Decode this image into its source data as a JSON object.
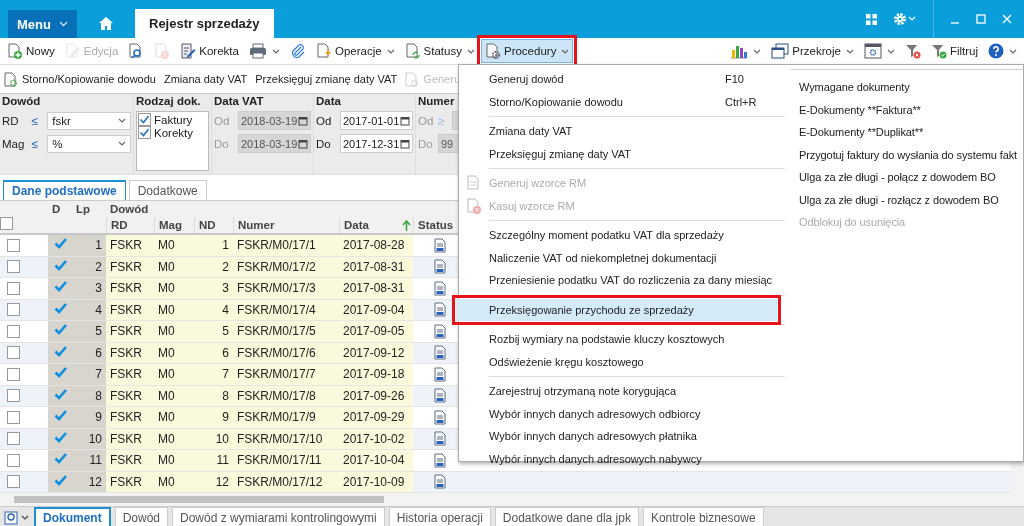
{
  "title_bar": {
    "menu": "Menu",
    "tabs": [
      {
        "label": "Rejestr sprzedaży",
        "selected": true
      }
    ]
  },
  "toolbar": {
    "left": [
      {
        "kind": "new",
        "label": "Nowy",
        "dropdown": false,
        "disabled": false,
        "open": false
      },
      {
        "kind": "edit",
        "label": "Edycja",
        "dropdown": false,
        "disabled": true,
        "open": false
      },
      {
        "kind": "preview",
        "dropdown": false,
        "disabled": false,
        "open": false
      },
      {
        "kind": "delete",
        "dropdown": false,
        "disabled": true,
        "open": false
      },
      {
        "kind": "correct",
        "label": "Korekta",
        "dropdown": false,
        "disabled": false,
        "open": false
      },
      {
        "kind": "print",
        "dropdown": true,
        "disabled": false,
        "open": false
      },
      {
        "kind": "clip",
        "dropdown": false,
        "disabled": false,
        "open": false
      },
      {
        "kind": "operations",
        "label": "Operacje",
        "dropdown": true,
        "disabled": false,
        "open": false
      },
      {
        "kind": "status",
        "label": "Statusy",
        "dropdown": true,
        "disabled": false,
        "open": false
      },
      {
        "kind": "procedures",
        "label": "Procedury",
        "dropdown": true,
        "disabled": false,
        "open": true
      }
    ],
    "right": [
      {
        "kind": "chart",
        "dropdown": true,
        "disabled": false,
        "open": false
      },
      {
        "kind": "window",
        "label": "Przekroje",
        "dropdown": true,
        "disabled": false,
        "open": false
      },
      {
        "kind": "settings",
        "dropdown": true,
        "disabled": false,
        "open": false
      },
      {
        "kind": "filterclear",
        "dropdown": false,
        "disabled": false,
        "open": false
      },
      {
        "kind": "filter",
        "label": "Filtruj",
        "dropdown": false,
        "disabled": false,
        "open": false
      },
      {
        "kind": "help",
        "dropdown": true,
        "disabled": false,
        "open": false
      }
    ]
  },
  "action_bar": [
    {
      "label": "Storno/Kopiowanie dowodu",
      "kind": "icon",
      "disabled": false
    },
    {
      "label": "Zmiana daty VAT",
      "kind": "text",
      "disabled": false
    },
    {
      "label": "Przeksięguj zmianę daty VAT",
      "kind": "text",
      "disabled": false
    },
    {
      "label": "Generu",
      "kind": "icon",
      "disabled": true
    }
  ],
  "filters": {
    "dowod": {
      "title": "Dowód",
      "fields": [
        {
          "label": "RD",
          "op": "≤",
          "value": "fskr"
        },
        {
          "label": "Mag",
          "op": "≤",
          "value": "%"
        }
      ]
    },
    "rodzaj": {
      "title": "Rodzaj dok.",
      "options": [
        {
          "label": "Faktury",
          "checked": true
        },
        {
          "label": "Korekty",
          "checked": true
        }
      ]
    },
    "ranges": [
      {
        "title": "Data VAT",
        "fields": [
          {
            "label": "Od",
            "value": "2018-03-19",
            "disabled": true
          },
          {
            "label": "Do",
            "value": "2018-03-19",
            "disabled": true
          }
        ]
      },
      {
        "title": "Data",
        "fields": [
          {
            "label": "Od",
            "value": "2017-01-01",
            "disabled": false
          },
          {
            "label": "Do",
            "value": "2017-12-31",
            "disabled": false
          }
        ]
      }
    ],
    "numer": {
      "title": "Numer",
      "fields": [
        {
          "label": "Od",
          "op": "≥"
        },
        {
          "label": "Do",
          "value": "99"
        }
      ]
    }
  },
  "view_tabs": [
    {
      "label": "Dane podstawowe",
      "selected": true
    },
    {
      "label": "Dodatkowe",
      "selected": false
    }
  ],
  "table": {
    "all_checked": false,
    "columns": [
      "D",
      "Lp"
    ],
    "group": "Dowód",
    "subcolumns": [
      {
        "label": "RD",
        "sorted": false
      },
      {
        "label": "Mag",
        "sorted": false
      },
      {
        "label": "ND",
        "sorted": false
      },
      {
        "label": "Numer",
        "sorted": false
      },
      {
        "label": "Data",
        "sorted": true
      },
      {
        "label": "Status",
        "sorted": false
      }
    ],
    "rows": [
      {
        "marked": false,
        "d": true,
        "lp": "1",
        "rd": "FSKR",
        "mag": "M0",
        "nd": "1",
        "numer": "FSKR/M0/17/1",
        "data": "2017-08-28"
      },
      {
        "marked": false,
        "d": true,
        "lp": "2",
        "rd": "FSKR",
        "mag": "M0",
        "nd": "2",
        "numer": "FSKR/M0/17/2",
        "data": "2017-08-31"
      },
      {
        "marked": false,
        "d": true,
        "lp": "3",
        "rd": "FSKR",
        "mag": "M0",
        "nd": "3",
        "numer": "FSKR/M0/17/3",
        "data": "2017-08-31"
      },
      {
        "marked": false,
        "d": true,
        "lp": "4",
        "rd": "FSKR",
        "mag": "M0",
        "nd": "4",
        "numer": "FSKR/M0/17/4",
        "data": "2017-09-04"
      },
      {
        "marked": false,
        "d": true,
        "lp": "5",
        "rd": "FSKR",
        "mag": "M0",
        "nd": "5",
        "numer": "FSKR/M0/17/5",
        "data": "2017-09-05"
      },
      {
        "marked": false,
        "d": true,
        "lp": "6",
        "rd": "FSKR",
        "mag": "M0",
        "nd": "6",
        "numer": "FSKR/M0/17/6",
        "data": "2017-09-12"
      },
      {
        "marked": false,
        "d": true,
        "lp": "7",
        "rd": "FSKR",
        "mag": "M0",
        "nd": "7",
        "numer": "FSKR/M0/17/7",
        "data": "2017-09-18"
      },
      {
        "marked": false,
        "d": true,
        "lp": "8",
        "rd": "FSKR",
        "mag": "M0",
        "nd": "8",
        "numer": "FSKR/M0/17/8",
        "data": "2017-09-26"
      },
      {
        "marked": false,
        "d": true,
        "lp": "9",
        "rd": "FSKR",
        "mag": "M0",
        "nd": "9",
        "numer": "FSKR/M0/17/9",
        "data": "2017-09-29"
      },
      {
        "marked": false,
        "d": true,
        "lp": "10",
        "rd": "FSKR",
        "mag": "M0",
        "nd": "10",
        "numer": "FSKR/M0/17/10",
        "data": "2017-10-02"
      },
      {
        "marked": false,
        "d": true,
        "lp": "11",
        "rd": "FSKR",
        "mag": "M0",
        "nd": "11",
        "numer": "FSKR/M0/17/11",
        "data": "2017-10-04"
      },
      {
        "marked": false,
        "d": true,
        "lp": "12",
        "rd": "FSKR",
        "mag": "M0",
        "nd": "12",
        "numer": "FSKR/M0/17/12",
        "data": "2017-10-09"
      }
    ]
  },
  "bottom_tabs": [
    {
      "label": "Dokument",
      "selected": true
    },
    {
      "label": "Dowód",
      "selected": false
    },
    {
      "label": "Dowód z wymiarami kontrolingowymi",
      "selected": false
    },
    {
      "label": "Historia operacji",
      "selected": false
    },
    {
      "label": "Dodatkowe dane dla jpk",
      "selected": false
    },
    {
      "label": "Kontrole biznesowe",
      "selected": false
    }
  ],
  "procedures_menu": {
    "groups": [
      [
        {
          "label": "Generuj dowód",
          "shortcut": "F10",
          "kind": "plain",
          "disabled": false,
          "highlighted": false
        },
        {
          "label": "Storno/Kopiowanie dowodu",
          "shortcut": "Ctrl+R",
          "kind": "plain",
          "disabled": false,
          "highlighted": false
        }
      ],
      [
        {
          "label": "Zmiana daty VAT",
          "kind": "plain",
          "disabled": false,
          "highlighted": false
        },
        {
          "label": "Przeksięguj zmianę daty VAT",
          "kind": "plain",
          "disabled": false,
          "highlighted": false
        }
      ],
      [
        {
          "label": "Generuj wzorce RM",
          "kind": "doc",
          "disabled": true,
          "highlighted": false
        },
        {
          "label": "Kasuj wzorce RM",
          "kind": "docdelete",
          "disabled": true,
          "highlighted": false
        }
      ],
      [
        {
          "label": "Szczególny moment podatku VAT dla sprzedaży",
          "kind": "plain",
          "disabled": false,
          "highlighted": false
        },
        {
          "label": "Naliczenie VAT od niekompletnej dokumentacji",
          "kind": "plain",
          "disabled": false,
          "highlighted": false
        },
        {
          "label": "Przeniesienie podatku VAT do rozliczenia za dany miesiąc",
          "kind": "plain",
          "disabled": false,
          "highlighted": false
        }
      ],
      [
        {
          "label": "Przeksięgowanie przychodu ze sprzedaży",
          "kind": "plain",
          "disabled": false,
          "highlighted": true
        }
      ],
      [
        {
          "label": "Rozbij wymiary na podstawie kluczy kosztowych",
          "kind": "plain",
          "disabled": false,
          "highlighted": false
        },
        {
          "label": "Odświeżenie kręgu kosztowego",
          "kind": "plain",
          "disabled": false,
          "highlighted": false
        }
      ],
      [
        {
          "label": "Zarejestruj otrzymaną note korygująca",
          "kind": "plain",
          "disabled": false,
          "highlighted": false
        },
        {
          "label": "Wybór innych danych adresowych odbiorcy",
          "kind": "plain",
          "disabled": false,
          "highlighted": false
        },
        {
          "label": "Wybór innych danych adresowych płatnika",
          "kind": "plain",
          "disabled": false,
          "highlighted": false
        },
        {
          "label": "Wybór innych danych adresowych nabywcy",
          "kind": "plain",
          "disabled": false,
          "highlighted": false
        }
      ]
    ],
    "side": [
      {
        "label": "Wymagane dokumenty",
        "disabled": false
      },
      {
        "label": "E-Dokumenty **Faktura**",
        "disabled": false
      },
      {
        "label": "E-Dokumenty **Duplikat**",
        "disabled": false
      },
      {
        "label": "Przygotuj faktury do wysłania do systemu fakt",
        "disabled": false
      },
      {
        "label": "Ulga za złe długi - połącz z dowodem BO",
        "disabled": false
      },
      {
        "label": "Ulga za złe długi - rozłącz z dowodem BO",
        "disabled": false
      },
      {
        "label": "Odblokuj do usunięcia",
        "disabled": true
      }
    ]
  }
}
